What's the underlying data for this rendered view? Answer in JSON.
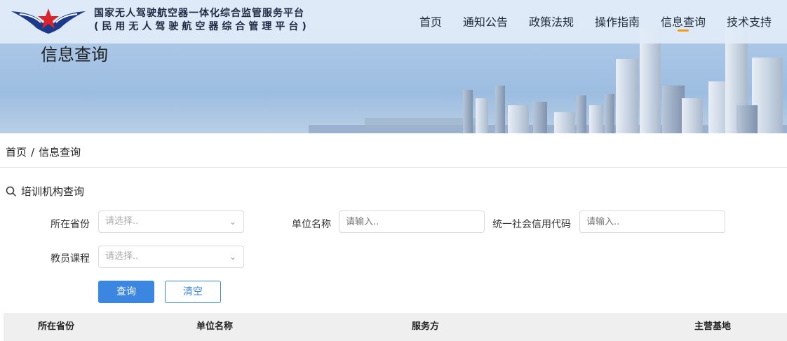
{
  "header": {
    "brand_line1": "国家无人驾驶航空器一体化综合监管服务平台",
    "brand_line2": "(民用无人驾驶航空器综合管理平台)",
    "nav": [
      {
        "label": "首页"
      },
      {
        "label": "通知公告"
      },
      {
        "label": "政策法规"
      },
      {
        "label": "操作指南"
      },
      {
        "label": "信息查询",
        "active": true
      },
      {
        "label": "技术支持"
      }
    ],
    "accent_color": "#f39c12"
  },
  "banner": {
    "title": "信息查询"
  },
  "breadcrumb": {
    "home": "首页",
    "separator": "/",
    "current": "信息查询"
  },
  "search": {
    "section_title": "培训机构查询",
    "province": {
      "label": "所在省份",
      "placeholder": "请选择.."
    },
    "unit_name": {
      "label": "单位名称",
      "placeholder": "请输入.."
    },
    "credit_code": {
      "label": "统一社会信用代码",
      "placeholder": "请输入.."
    },
    "course": {
      "label": "教员课程",
      "placeholder": "请选择.."
    },
    "query_button": "查询",
    "clear_button": "清空",
    "primary_color": "#3a86e0"
  },
  "table": {
    "columns": [
      "所在省份",
      "单位名称",
      "服务方",
      "主营基地"
    ]
  }
}
